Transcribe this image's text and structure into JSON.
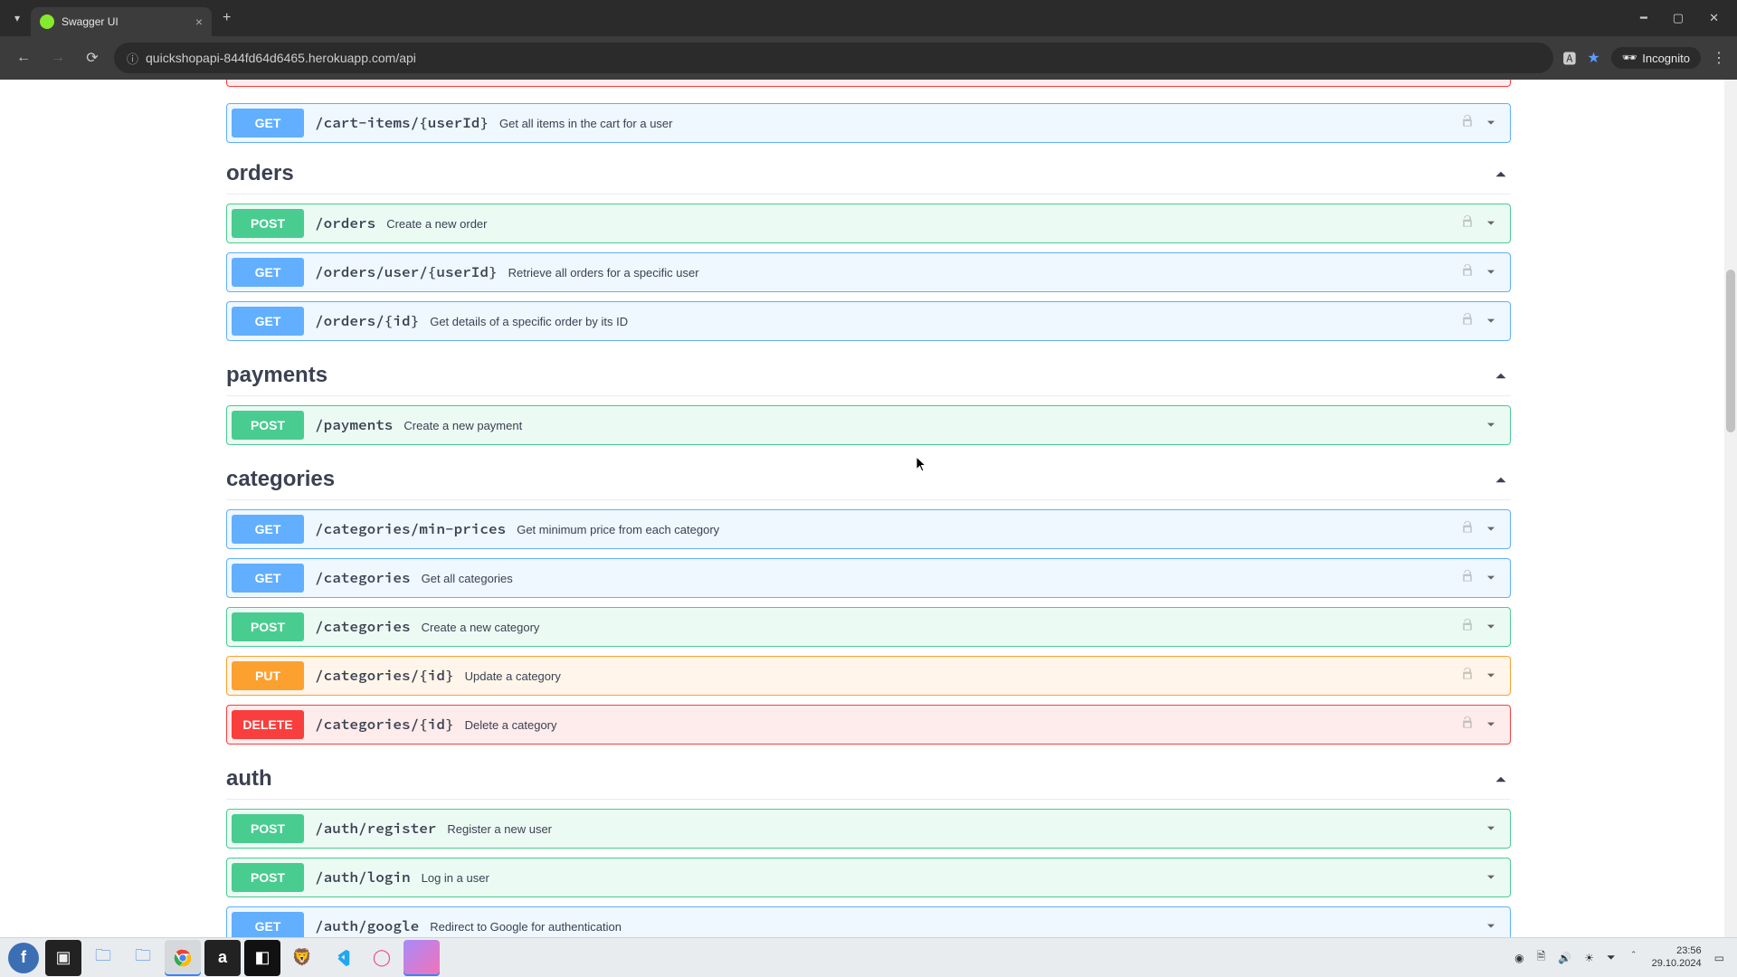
{
  "browser": {
    "tab_title": "Swagger UI",
    "url": "quickshopapi-844fd64d6465.herokuapp.com/api",
    "incognito_label": "Incognito"
  },
  "loose_endpoint": {
    "method": "GET",
    "path": "/cart-items/{userId}",
    "desc": "Get all items in the cart for a user"
  },
  "sections": [
    {
      "tag": "orders",
      "endpoints": [
        {
          "method": "POST",
          "klass": "op-post",
          "path": "/orders",
          "desc": "Create a new order",
          "lock": true
        },
        {
          "method": "GET",
          "klass": "op-get",
          "path": "/orders/user/{userId}",
          "desc": "Retrieve all orders for a specific user",
          "lock": true
        },
        {
          "method": "GET",
          "klass": "op-get",
          "path": "/orders/{id}",
          "desc": "Get details of a specific order by its ID",
          "lock": true
        }
      ]
    },
    {
      "tag": "payments",
      "endpoints": [
        {
          "method": "POST",
          "klass": "op-post",
          "path": "/payments",
          "desc": "Create a new payment",
          "lock": false
        }
      ]
    },
    {
      "tag": "categories",
      "endpoints": [
        {
          "method": "GET",
          "klass": "op-get",
          "path": "/categories/min-prices",
          "desc": "Get minimum price from each category",
          "lock": true
        },
        {
          "method": "GET",
          "klass": "op-get",
          "path": "/categories",
          "desc": "Get all categories",
          "lock": true
        },
        {
          "method": "POST",
          "klass": "op-post",
          "path": "/categories",
          "desc": "Create a new category",
          "lock": true
        },
        {
          "method": "PUT",
          "klass": "op-put",
          "path": "/categories/{id}",
          "desc": "Update a category",
          "lock": true
        },
        {
          "method": "DELETE",
          "klass": "op-delete",
          "path": "/categories/{id}",
          "desc": "Delete a category",
          "lock": true
        }
      ]
    },
    {
      "tag": "auth",
      "endpoints": [
        {
          "method": "POST",
          "klass": "op-post",
          "path": "/auth/register",
          "desc": "Register a new user",
          "lock": false
        },
        {
          "method": "POST",
          "klass": "op-post",
          "path": "/auth/login",
          "desc": "Log in a user",
          "lock": false
        },
        {
          "method": "GET",
          "klass": "op-get",
          "path": "/auth/google",
          "desc": "Redirect to Google for authentication",
          "lock": false
        }
      ]
    }
  ],
  "taskbar": {
    "time": "23:56",
    "date": "29.10.2024"
  }
}
